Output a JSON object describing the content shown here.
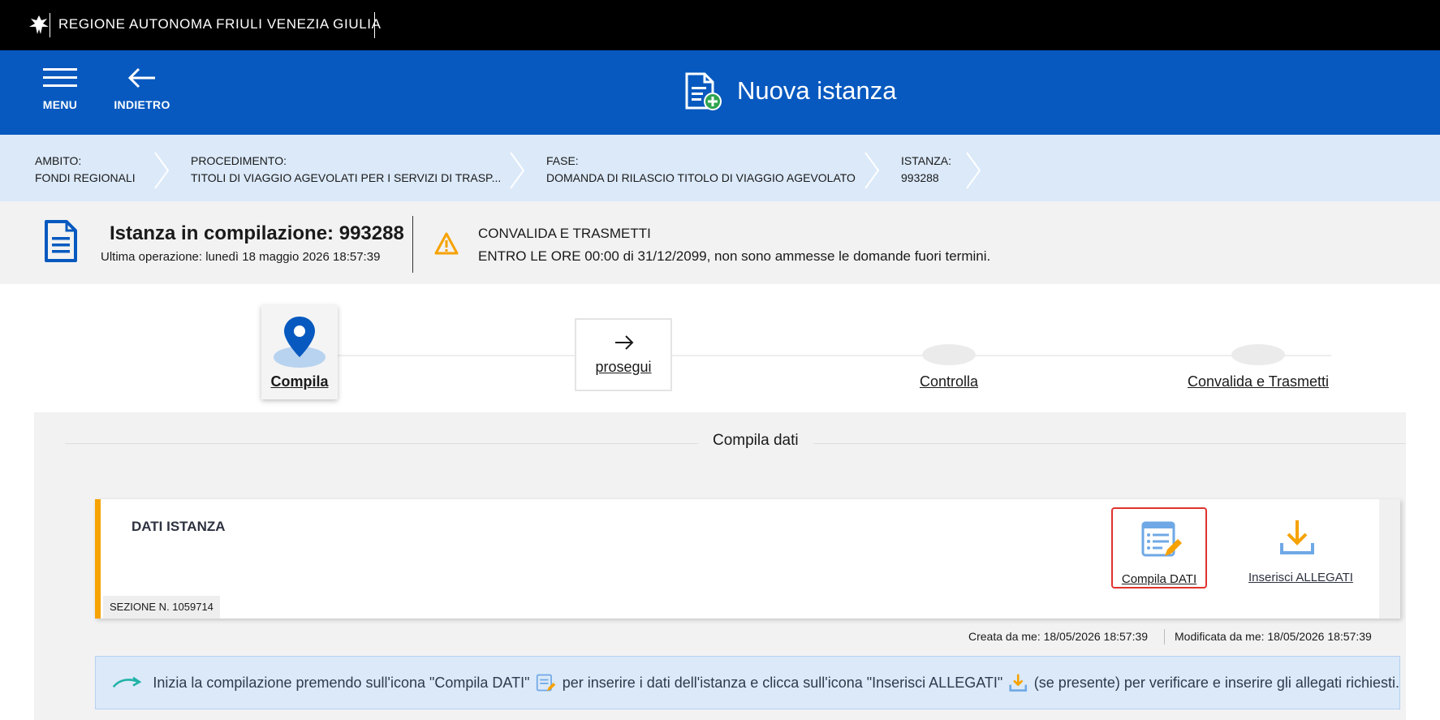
{
  "topbar": {
    "region_name": "REGIONE AUTONOMA FRIULI VENEZIA GIULIA"
  },
  "header": {
    "menu_label": "MENU",
    "back_label": "INDIETRO",
    "title": "Nuova istanza"
  },
  "breadcrumb": [
    {
      "key": "AMBITO:",
      "value": "FONDI REGIONALI"
    },
    {
      "key": "PROCEDIMENTO:",
      "value": "TITOLI DI VIAGGIO AGEVOLATI PER I SERVIZI DI TRASP..."
    },
    {
      "key": "FASE:",
      "value": "DOMANDA DI RILASCIO TITOLO DI VIAGGIO AGEVOLATO"
    },
    {
      "key": "ISTANZA:",
      "value": "993288"
    }
  ],
  "status": {
    "title": "Istanza in compilazione: 993288",
    "last_operation": "Ultima operazione: lunedì 18 maggio 2026 18:57:39",
    "warning_title": "CONVALIDA E TRASMETTI",
    "warning_text": "ENTRO LE ORE 00:00 di 31/12/2099, non sono ammesse le domande fuori termini."
  },
  "stepper": {
    "steps": [
      {
        "label": "Compila",
        "state": "active"
      },
      {
        "label": "prosegui",
        "state": "next"
      },
      {
        "label": "Controlla",
        "state": "pending"
      },
      {
        "label": "Convalida e Trasmetti",
        "state": "pending"
      }
    ]
  },
  "panel": {
    "title": "Compila dati",
    "card": {
      "title": "DATI ISTANZA",
      "section": "SEZIONE N. 1059714",
      "compila_label": "Compila DATI",
      "allegati_label": "Inserisci ALLEGATI"
    },
    "created": "Creata da me: 18/05/2026 18:57:39",
    "modified": "Modificata da me: 18/05/2026 18:57:39",
    "hint": {
      "part1": "Inizia la compilazione premendo sull'icona \"Compila DATI\"",
      "part2": "per inserire i dati dell'istanza e clicca sull'icona \"Inserisci ALLEGATI\"",
      "part3": "(se presente) per verificare e inserire gli allegati richiesti."
    }
  },
  "colors": {
    "header_blue": "#0759bf",
    "accent_orange": "#f6a200",
    "highlight_red": "#e0332f",
    "breadcrumb_bg": "#dbe9f9"
  }
}
